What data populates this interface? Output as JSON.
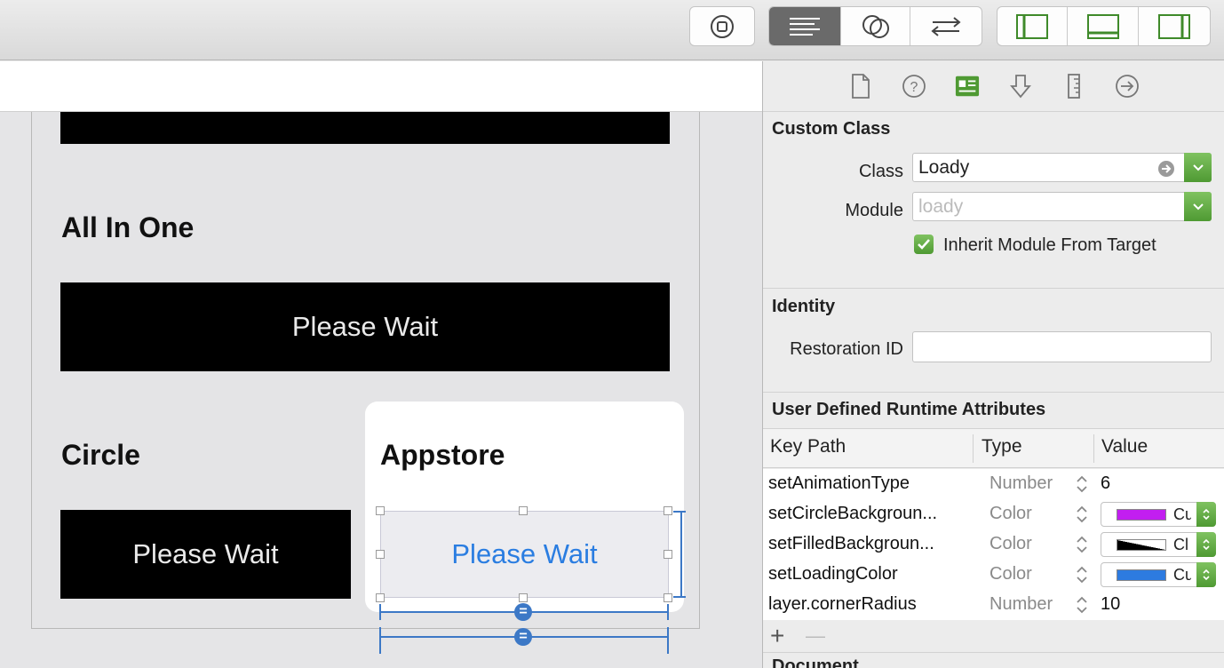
{
  "toolbar": {
    "icons": [
      "stop-icon",
      "standard-editor-icon",
      "assistant-editor-icon",
      "version-editor-icon",
      "navigator-toggle-icon",
      "debug-area-toggle-icon",
      "inspector-toggle-icon"
    ],
    "accent_color": "#6a6a6a"
  },
  "canvas": {
    "sections": [
      {
        "heading": "All In One",
        "button_label": "Please Wait"
      },
      {
        "heading": "Circle",
        "button_label": "Please Wait"
      },
      {
        "heading": "Appstore",
        "button_label": "Please Wait"
      }
    ],
    "loady_text_color": "#2a7de1",
    "constraint_color": "#3c78c6"
  },
  "inspector": {
    "tabs": [
      "file-icon",
      "help-icon",
      "identity-icon",
      "attributes-icon",
      "size-icon",
      "connections-icon"
    ],
    "custom_class": {
      "title": "Custom Class",
      "class_label": "Class",
      "class_value": "Loady",
      "module_label": "Module",
      "module_placeholder": "loady",
      "inherit_label": "Inherit Module From Target",
      "inherit_checked": true
    },
    "identity": {
      "title": "Identity",
      "restoration_label": "Restoration ID",
      "restoration_value": ""
    },
    "runtime": {
      "title": "User Defined Runtime Attributes",
      "columns": [
        "Key Path",
        "Type",
        "Value"
      ],
      "rows": [
        {
          "key": "setAnimationType",
          "type": "Number",
          "value": "6"
        },
        {
          "key": "setCircleBackgroun...",
          "type": "Color",
          "value": "Cu",
          "swatch": "#c21ef0"
        },
        {
          "key": "setFilledBackgroun...",
          "type": "Color",
          "value": "Cl",
          "swatch": "#000000"
        },
        {
          "key": "setLoadingColor",
          "type": "Color",
          "value": "Cu",
          "swatch": "#2d7be0"
        },
        {
          "key": "layer.cornerRadius",
          "type": "Number",
          "value": "10"
        }
      ],
      "add_symbol": "+",
      "remove_symbol": "—"
    },
    "document_title": "Document"
  }
}
